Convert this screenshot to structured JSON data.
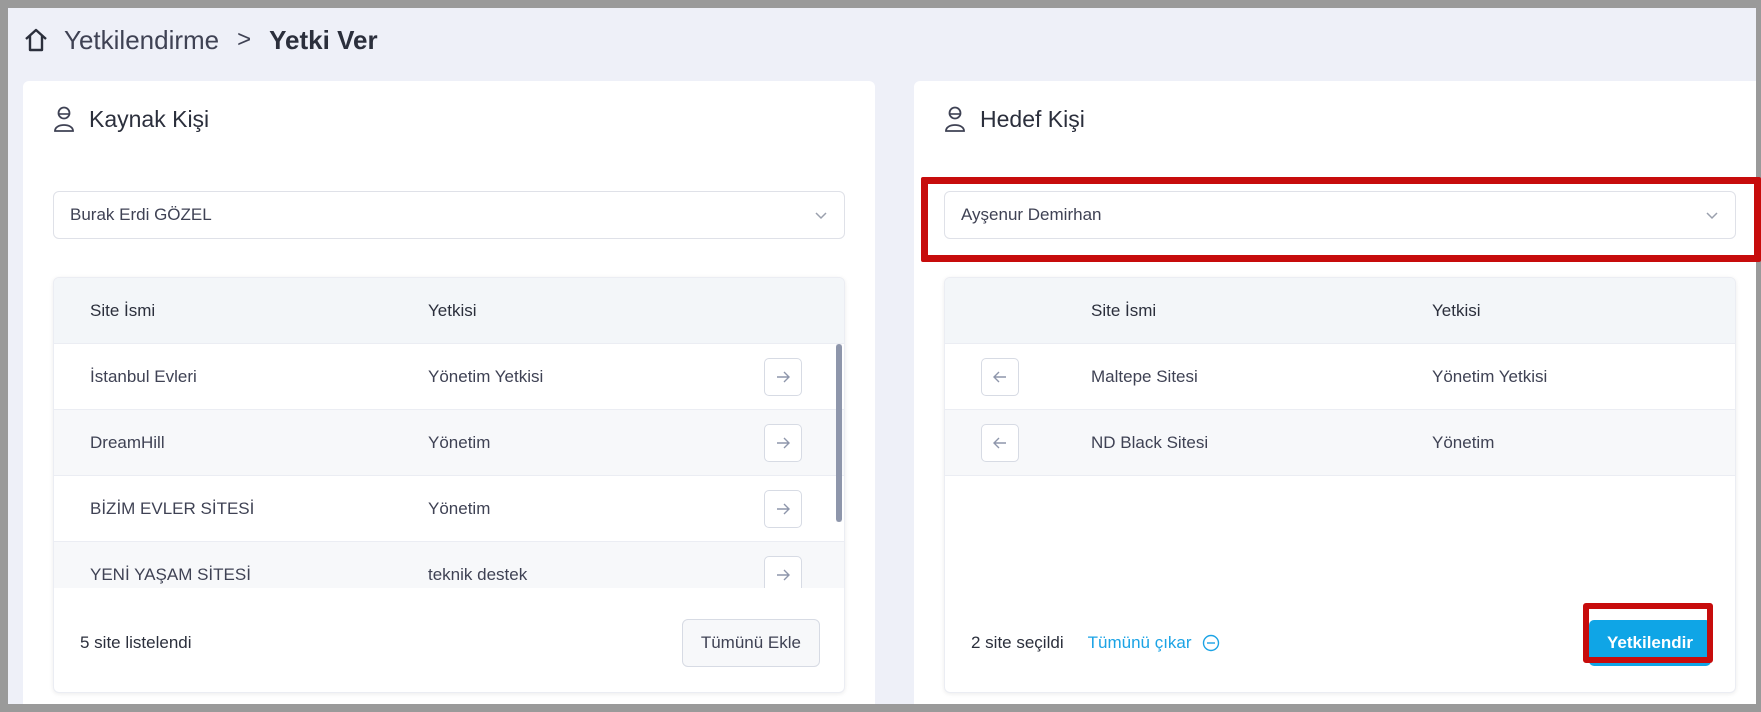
{
  "breadcrumb": {
    "parent": "Yetkilendirme",
    "separator": ">",
    "current": "Yetki Ver"
  },
  "source": {
    "title": "Kaynak Kişi",
    "selected_person": "Burak Erdi GÖZEL",
    "columns": [
      "Site İsmi",
      "Yetkisi"
    ],
    "rows": [
      {
        "site": "İstanbul Evleri",
        "role": "Yönetim Yetkisi"
      },
      {
        "site": "DreamHill",
        "role": "Yönetim"
      },
      {
        "site": "BİZİM EVLER SİTESİ",
        "role": "Yönetim"
      },
      {
        "site": "YENİ YAŞAM SİTESİ",
        "role": "teknik destek"
      }
    ],
    "footer_text": "5 site listelendi",
    "add_all_label": "Tümünü Ekle"
  },
  "target": {
    "title": "Hedef Kişi",
    "selected_person": "Ayşenur Demirhan",
    "columns": [
      "Site İsmi",
      "Yetkisi"
    ],
    "rows": [
      {
        "site": "Maltepe Sitesi",
        "role": "Yönetim Yetkisi"
      },
      {
        "site": "ND Black Sitesi",
        "role": "Yönetim"
      }
    ],
    "footer_text": "2 site seçildi",
    "remove_all_label": "Tümünü çıkar",
    "authorize_label": "Yetkilendir"
  },
  "colors": {
    "accent": "#0fa5e6",
    "highlight": "#c70c0c",
    "link": "#1ba3e5"
  },
  "icons": [
    "home-icon",
    "person-icon",
    "chevron-down-icon",
    "arrow-right-icon",
    "arrow-left-icon",
    "minus-circle-icon"
  ]
}
